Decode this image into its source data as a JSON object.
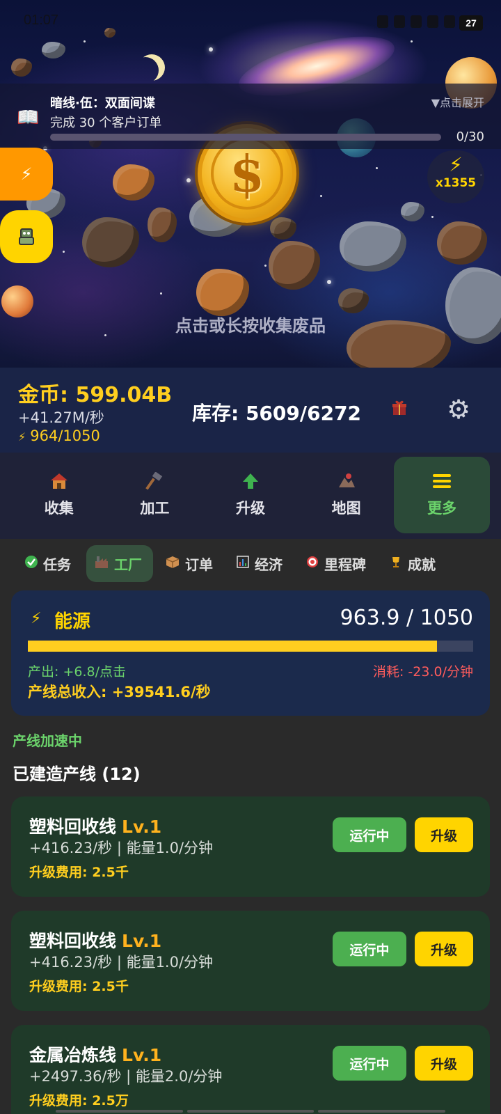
{
  "status": {
    "time": "01:07",
    "battery": "27"
  },
  "quest": {
    "title": "暗线·伍：双面间谍",
    "desc": "完成 30 个客户订单",
    "expand": "▼点击展开",
    "progress_text": "0/30",
    "progress": 0
  },
  "boost": {
    "multiplier": "x1355"
  },
  "scene": {
    "tap_hint": "点击或长按收集废品"
  },
  "stats": {
    "gold": "金币: 599.04B",
    "rate": "+41.27M/秒",
    "energy": "964/1050",
    "stock": "库存: 5609/6272"
  },
  "nav": [
    {
      "label": "收集",
      "icon": "house-icon"
    },
    {
      "label": "加工",
      "icon": "hammer-icon"
    },
    {
      "label": "升级",
      "icon": "up-arrow-icon"
    },
    {
      "label": "地图",
      "icon": "map-icon"
    },
    {
      "label": "更多",
      "icon": "menu-icon",
      "active": true
    }
  ],
  "subtabs": [
    {
      "label": "任务",
      "icon": "check-icon"
    },
    {
      "label": "工厂",
      "icon": "factory-icon",
      "active": true
    },
    {
      "label": "订单",
      "icon": "box-icon"
    },
    {
      "label": "经济",
      "icon": "chart-icon"
    },
    {
      "label": "里程碑",
      "icon": "target-icon"
    },
    {
      "label": "成就",
      "icon": "trophy-icon"
    }
  ],
  "energy_card": {
    "title": "能源",
    "value": "963.9 / 1050",
    "fill_fraction": 0.918,
    "output": "产出: +6.8/点击",
    "consumption": "消耗: -23.0/分钟",
    "total_income": "产线总收入: +39541.6/秒"
  },
  "accelerating": "产线加速中",
  "built_title": "已建造产线 (12)",
  "lines": [
    {
      "name": "塑料回收线",
      "level": "Lv.1",
      "info": "+416.23/秒 | 能量1.0/分钟",
      "cost": "升级费用: 2.5千",
      "status": "运行中",
      "upgrade": "升级"
    },
    {
      "name": "塑料回收线",
      "level": "Lv.1",
      "info": "+416.23/秒 | 能量1.0/分钟",
      "cost": "升级费用: 2.5千",
      "status": "运行中",
      "upgrade": "升级"
    },
    {
      "name": "金属冶炼线",
      "level": "Lv.1",
      "info": "+2497.36/秒 | 能量2.0/分钟",
      "cost": "升级费用: 2.5万",
      "status": "运行中",
      "upgrade": "升级"
    }
  ],
  "colors": {
    "accent_green": "#6bd36b",
    "gold": "#ffce1f",
    "red": "#ff5c5c",
    "card_green": "#1f3a29",
    "card_blue": "#1b2a4c"
  }
}
